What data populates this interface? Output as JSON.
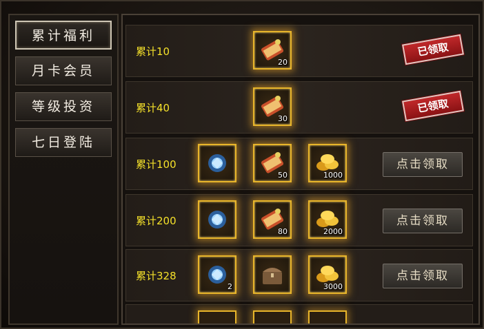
{
  "menu": {
    "tabs": [
      {
        "label": "累计福利",
        "active": true
      },
      {
        "label": "月卡会员",
        "active": false
      },
      {
        "label": "等级投资",
        "active": false
      },
      {
        "label": "七日登陆",
        "active": false
      }
    ]
  },
  "rewards": [
    {
      "label": "累计10",
      "items": [
        {
          "icon": "scroll-icon",
          "qty": "20"
        }
      ],
      "status": "已领取"
    },
    {
      "label": "累计40",
      "items": [
        {
          "icon": "scroll-icon",
          "qty": "30"
        }
      ],
      "status": "已领取"
    },
    {
      "label": "累计100",
      "items": [
        {
          "icon": "blue-gem-icon",
          "qty": ""
        },
        {
          "icon": "scroll-icon",
          "qty": "50"
        },
        {
          "icon": "gold-coins-icon",
          "qty": "1000"
        }
      ],
      "button": "点击领取"
    },
    {
      "label": "累计200",
      "items": [
        {
          "icon": "blue-gem-icon",
          "qty": ""
        },
        {
          "icon": "scroll-icon",
          "qty": "80"
        },
        {
          "icon": "gold-coins-icon",
          "qty": "2000"
        }
      ],
      "button": "点击领取"
    },
    {
      "label": "累计328",
      "items": [
        {
          "icon": "blue-gem-icon",
          "qty": "2"
        },
        {
          "icon": "treasure-chest-icon",
          "qty": ""
        },
        {
          "icon": "gold-coins-icon",
          "qty": "3000"
        }
      ],
      "button": "点击领取"
    }
  ],
  "colors": {
    "label": "#f5e12a",
    "slot_border": "#e8b52a",
    "stamp": "#b01e20"
  }
}
